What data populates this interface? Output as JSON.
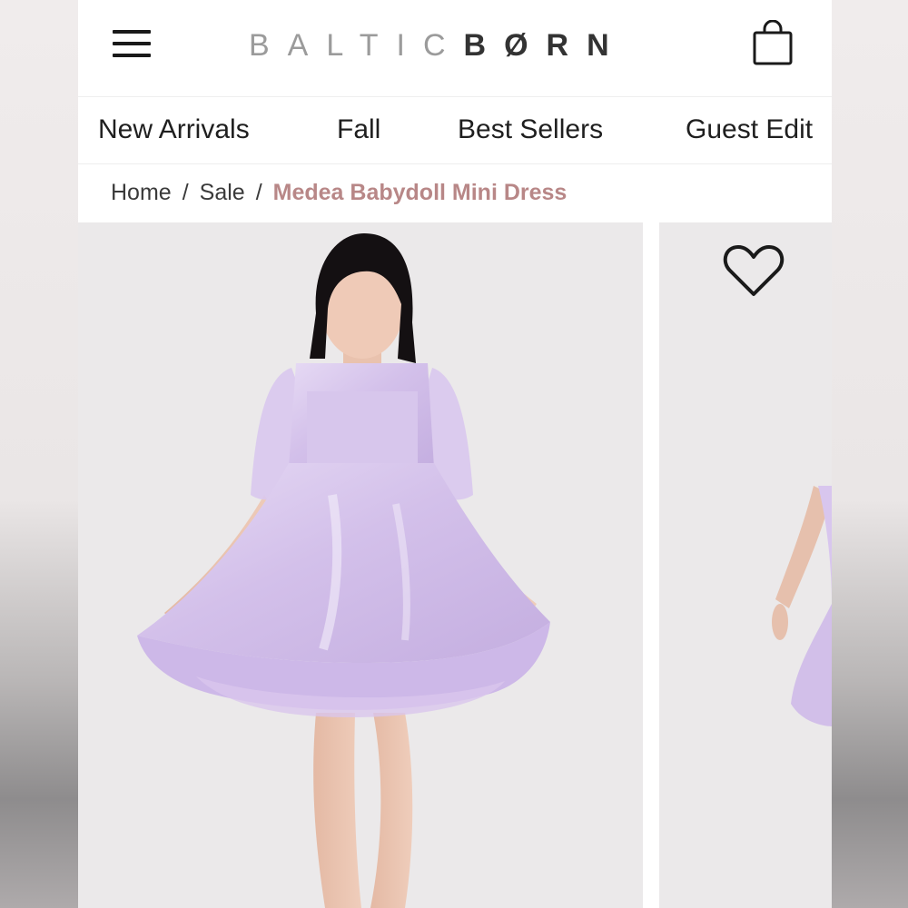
{
  "header": {
    "logo_light": "BALTIC",
    "logo_dark": "BØRN",
    "menu_icon": "hamburger-menu-icon",
    "cart_icon": "shopping-bag-icon"
  },
  "nav": {
    "items": [
      {
        "label": "New Arrivals"
      },
      {
        "label": "Fall"
      },
      {
        "label": "Best Sellers"
      },
      {
        "label": "Guest Edit"
      }
    ]
  },
  "breadcrumb": {
    "items": [
      {
        "label": "Home"
      },
      {
        "label": "Sale"
      }
    ],
    "separator": "/",
    "current": "Medea Babydoll Mini Dress"
  },
  "gallery": {
    "wishlist_icon": "heart-icon"
  },
  "colors": {
    "breadcrumb_current": "#b88787",
    "logo_light": "#9b9b9b",
    "logo_dark": "#333333",
    "dress": "#d6c4ec",
    "photo_background": "#ebe9ea"
  }
}
